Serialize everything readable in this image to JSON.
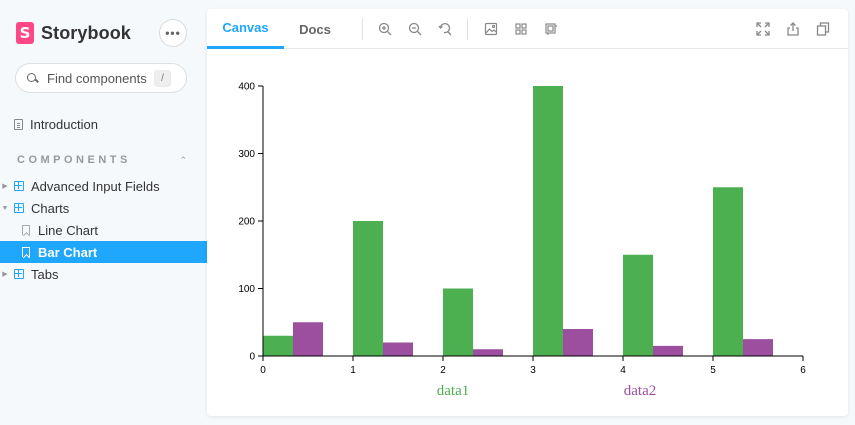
{
  "app": {
    "name": "Storybook",
    "logo_letter": "S",
    "more_label": "•••"
  },
  "search": {
    "placeholder": "Find components",
    "shortcut": "/"
  },
  "sidebar": {
    "top_items": [
      {
        "label": "Introduction",
        "icon": "document-icon"
      }
    ],
    "section_title": "COMPONENTS",
    "section_toggle": "⌃⌄",
    "items": [
      {
        "label": "Advanced Input Fields",
        "icon": "component-icon",
        "expanded": false
      },
      {
        "label": "Charts",
        "icon": "component-icon",
        "expanded": true
      },
      {
        "label": "Line Chart",
        "icon": "bookmark-icon",
        "selected": false
      },
      {
        "label": "Bar Chart",
        "icon": "bookmark-icon",
        "selected": true
      },
      {
        "label": "Tabs",
        "icon": "component-icon",
        "expanded": false
      }
    ]
  },
  "toolbar": {
    "tabs": [
      {
        "label": "Canvas",
        "active": true
      },
      {
        "label": "Docs",
        "active": false
      }
    ],
    "tools": [
      "zoom-in-icon",
      "zoom-out-icon",
      "zoom-reset-icon",
      "background-icon",
      "grid-icon",
      "outline-icon"
    ],
    "actions": [
      "fullscreen-icon",
      "share-icon",
      "copy-icon"
    ]
  },
  "colors": {
    "accent": "#1ea7fd",
    "data1": "#4caf50",
    "data2": "#9c4f9f",
    "brand": "#ff4785"
  },
  "chart_data": {
    "type": "bar",
    "x_ticks": [
      0,
      1,
      2,
      3,
      4,
      5,
      6
    ],
    "y_ticks": [
      0,
      100,
      200,
      300,
      400
    ],
    "xlim": [
      0,
      6
    ],
    "ylim": [
      0,
      400
    ],
    "grid": false,
    "legend_position": "bottom",
    "series": [
      {
        "name": "data1",
        "color": "#4caf50",
        "x": [
          0,
          1,
          2,
          3,
          4,
          5
        ],
        "values": [
          30,
          200,
          100,
          400,
          150,
          250
        ]
      },
      {
        "name": "data2",
        "color": "#9c4f9f",
        "x": [
          0,
          1,
          2,
          3,
          4,
          5
        ],
        "values": [
          50,
          20,
          10,
          40,
          15,
          25
        ]
      }
    ]
  }
}
